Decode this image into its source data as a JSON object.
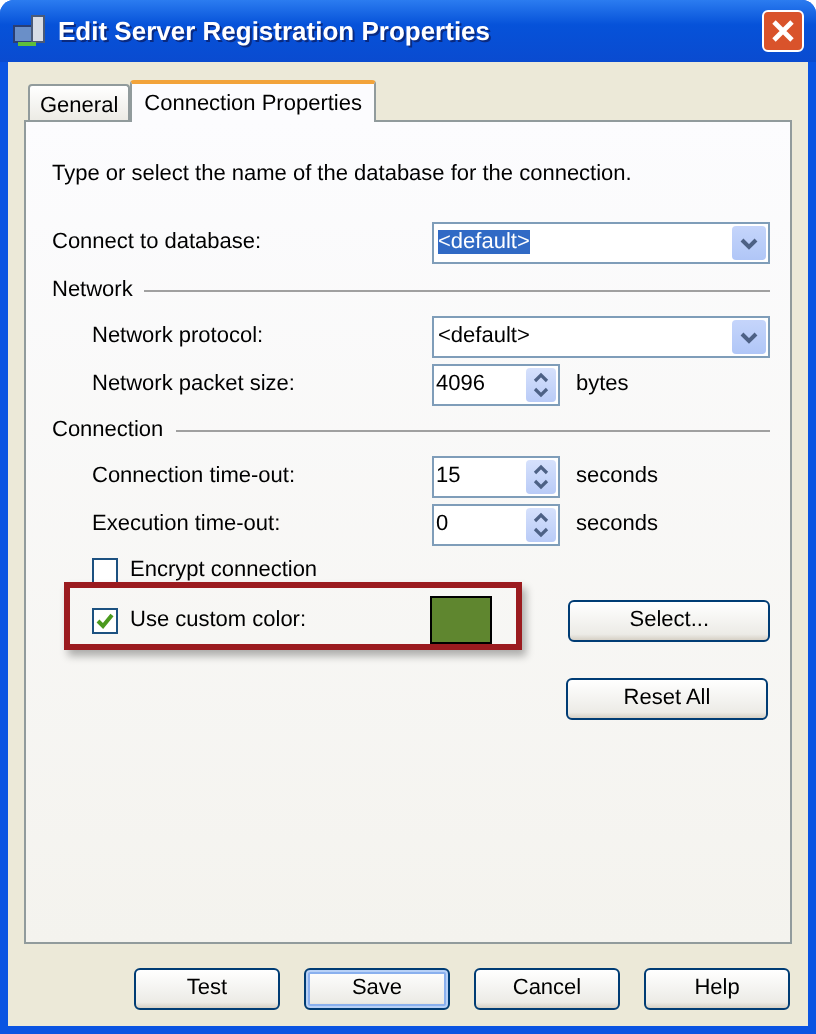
{
  "window": {
    "title": "Edit Server Registration Properties"
  },
  "tabs": [
    {
      "label": "General",
      "selected": false
    },
    {
      "label": "Connection Properties",
      "selected": true
    }
  ],
  "intro": "Type or select the name of the database for the connection.",
  "database": {
    "label": "Connect to database:",
    "value": "<default>",
    "highlighted": true
  },
  "network": {
    "heading": "Network",
    "protocol": {
      "label": "Network protocol:",
      "value": "<default>"
    },
    "packet_size": {
      "label": "Network packet size:",
      "value": "4096",
      "unit": "bytes"
    }
  },
  "connection": {
    "heading": "Connection",
    "timeouts": [
      {
        "label": "Connection time-out:",
        "value": "15",
        "unit": "seconds"
      },
      {
        "label": "Execution time-out:",
        "value": "0",
        "unit": "seconds"
      }
    ],
    "encrypt": {
      "label": "Encrypt connection",
      "checked": false
    },
    "custom_color": {
      "label": "Use custom color:",
      "checked": true,
      "color": "#5f862f"
    },
    "select_button": "Select...",
    "reset_button": "Reset All"
  },
  "buttons": [
    {
      "label": "Test",
      "default": false
    },
    {
      "label": "Save",
      "default": true
    },
    {
      "label": "Cancel",
      "default": false
    },
    {
      "label": "Help",
      "default": false
    }
  ]
}
